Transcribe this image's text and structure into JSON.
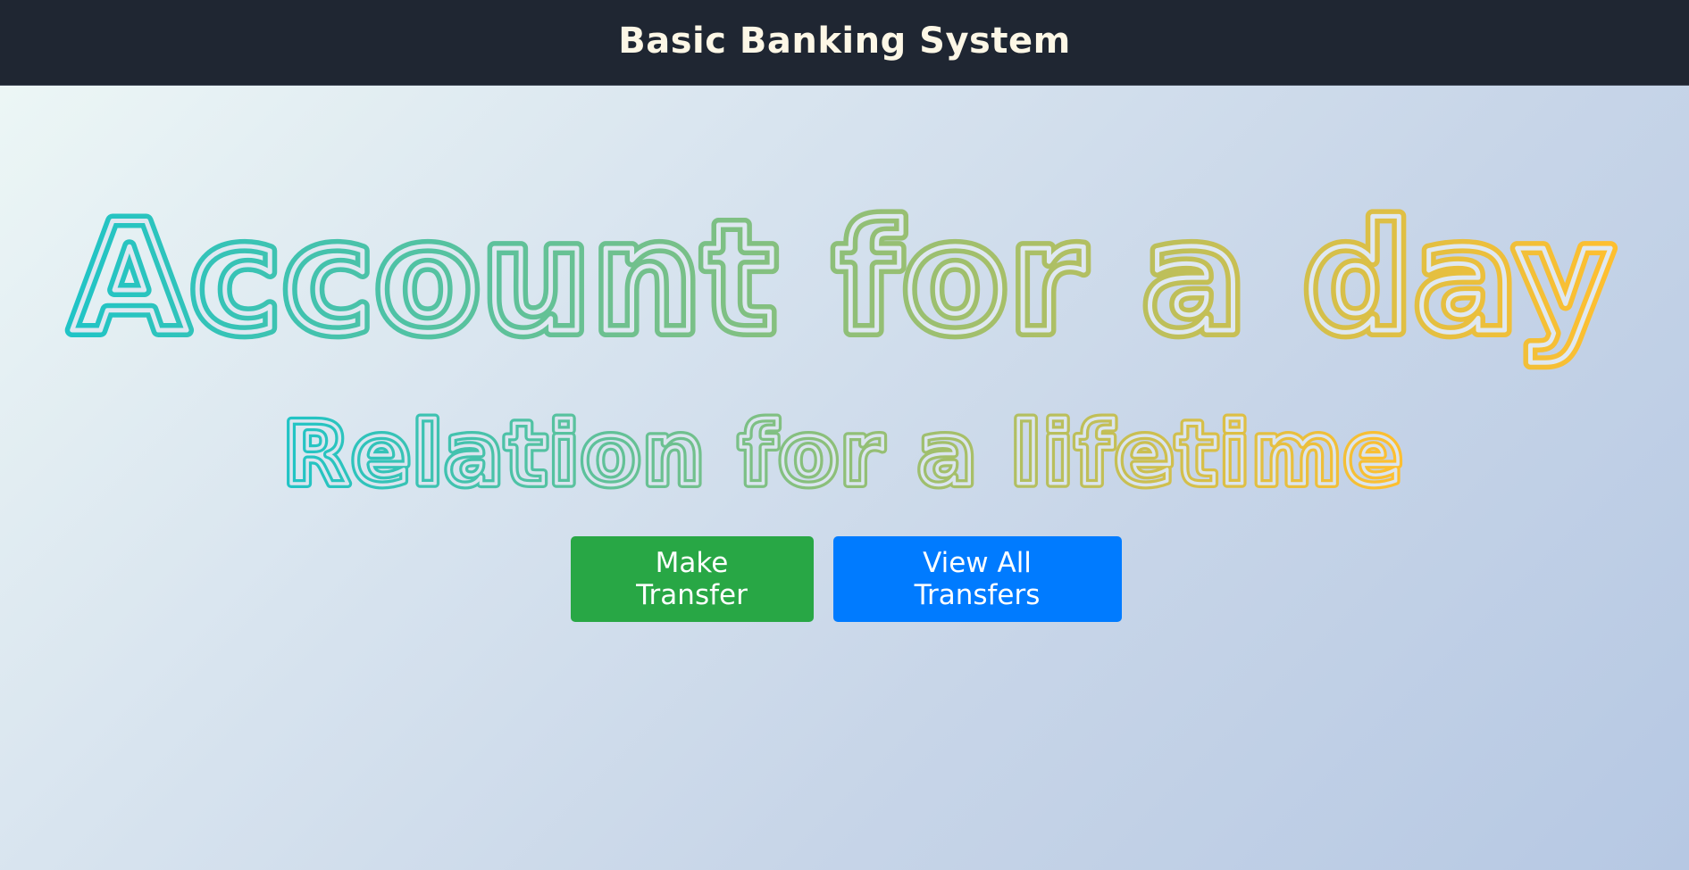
{
  "navbar": {
    "brand": "Basic Banking System"
  },
  "hero": {
    "headline": "Account for a day",
    "subheadline": "Relation for a lifetime",
    "gradient": {
      "start": "#20c4c6",
      "mid": "#8fbf78",
      "end": "#ffbf2f"
    }
  },
  "actions": {
    "make_transfer": "Make Transfer",
    "view_transfers": "View All Transfers",
    "make_transfer_color": "#28a745",
    "view_transfers_color": "#007bff"
  }
}
